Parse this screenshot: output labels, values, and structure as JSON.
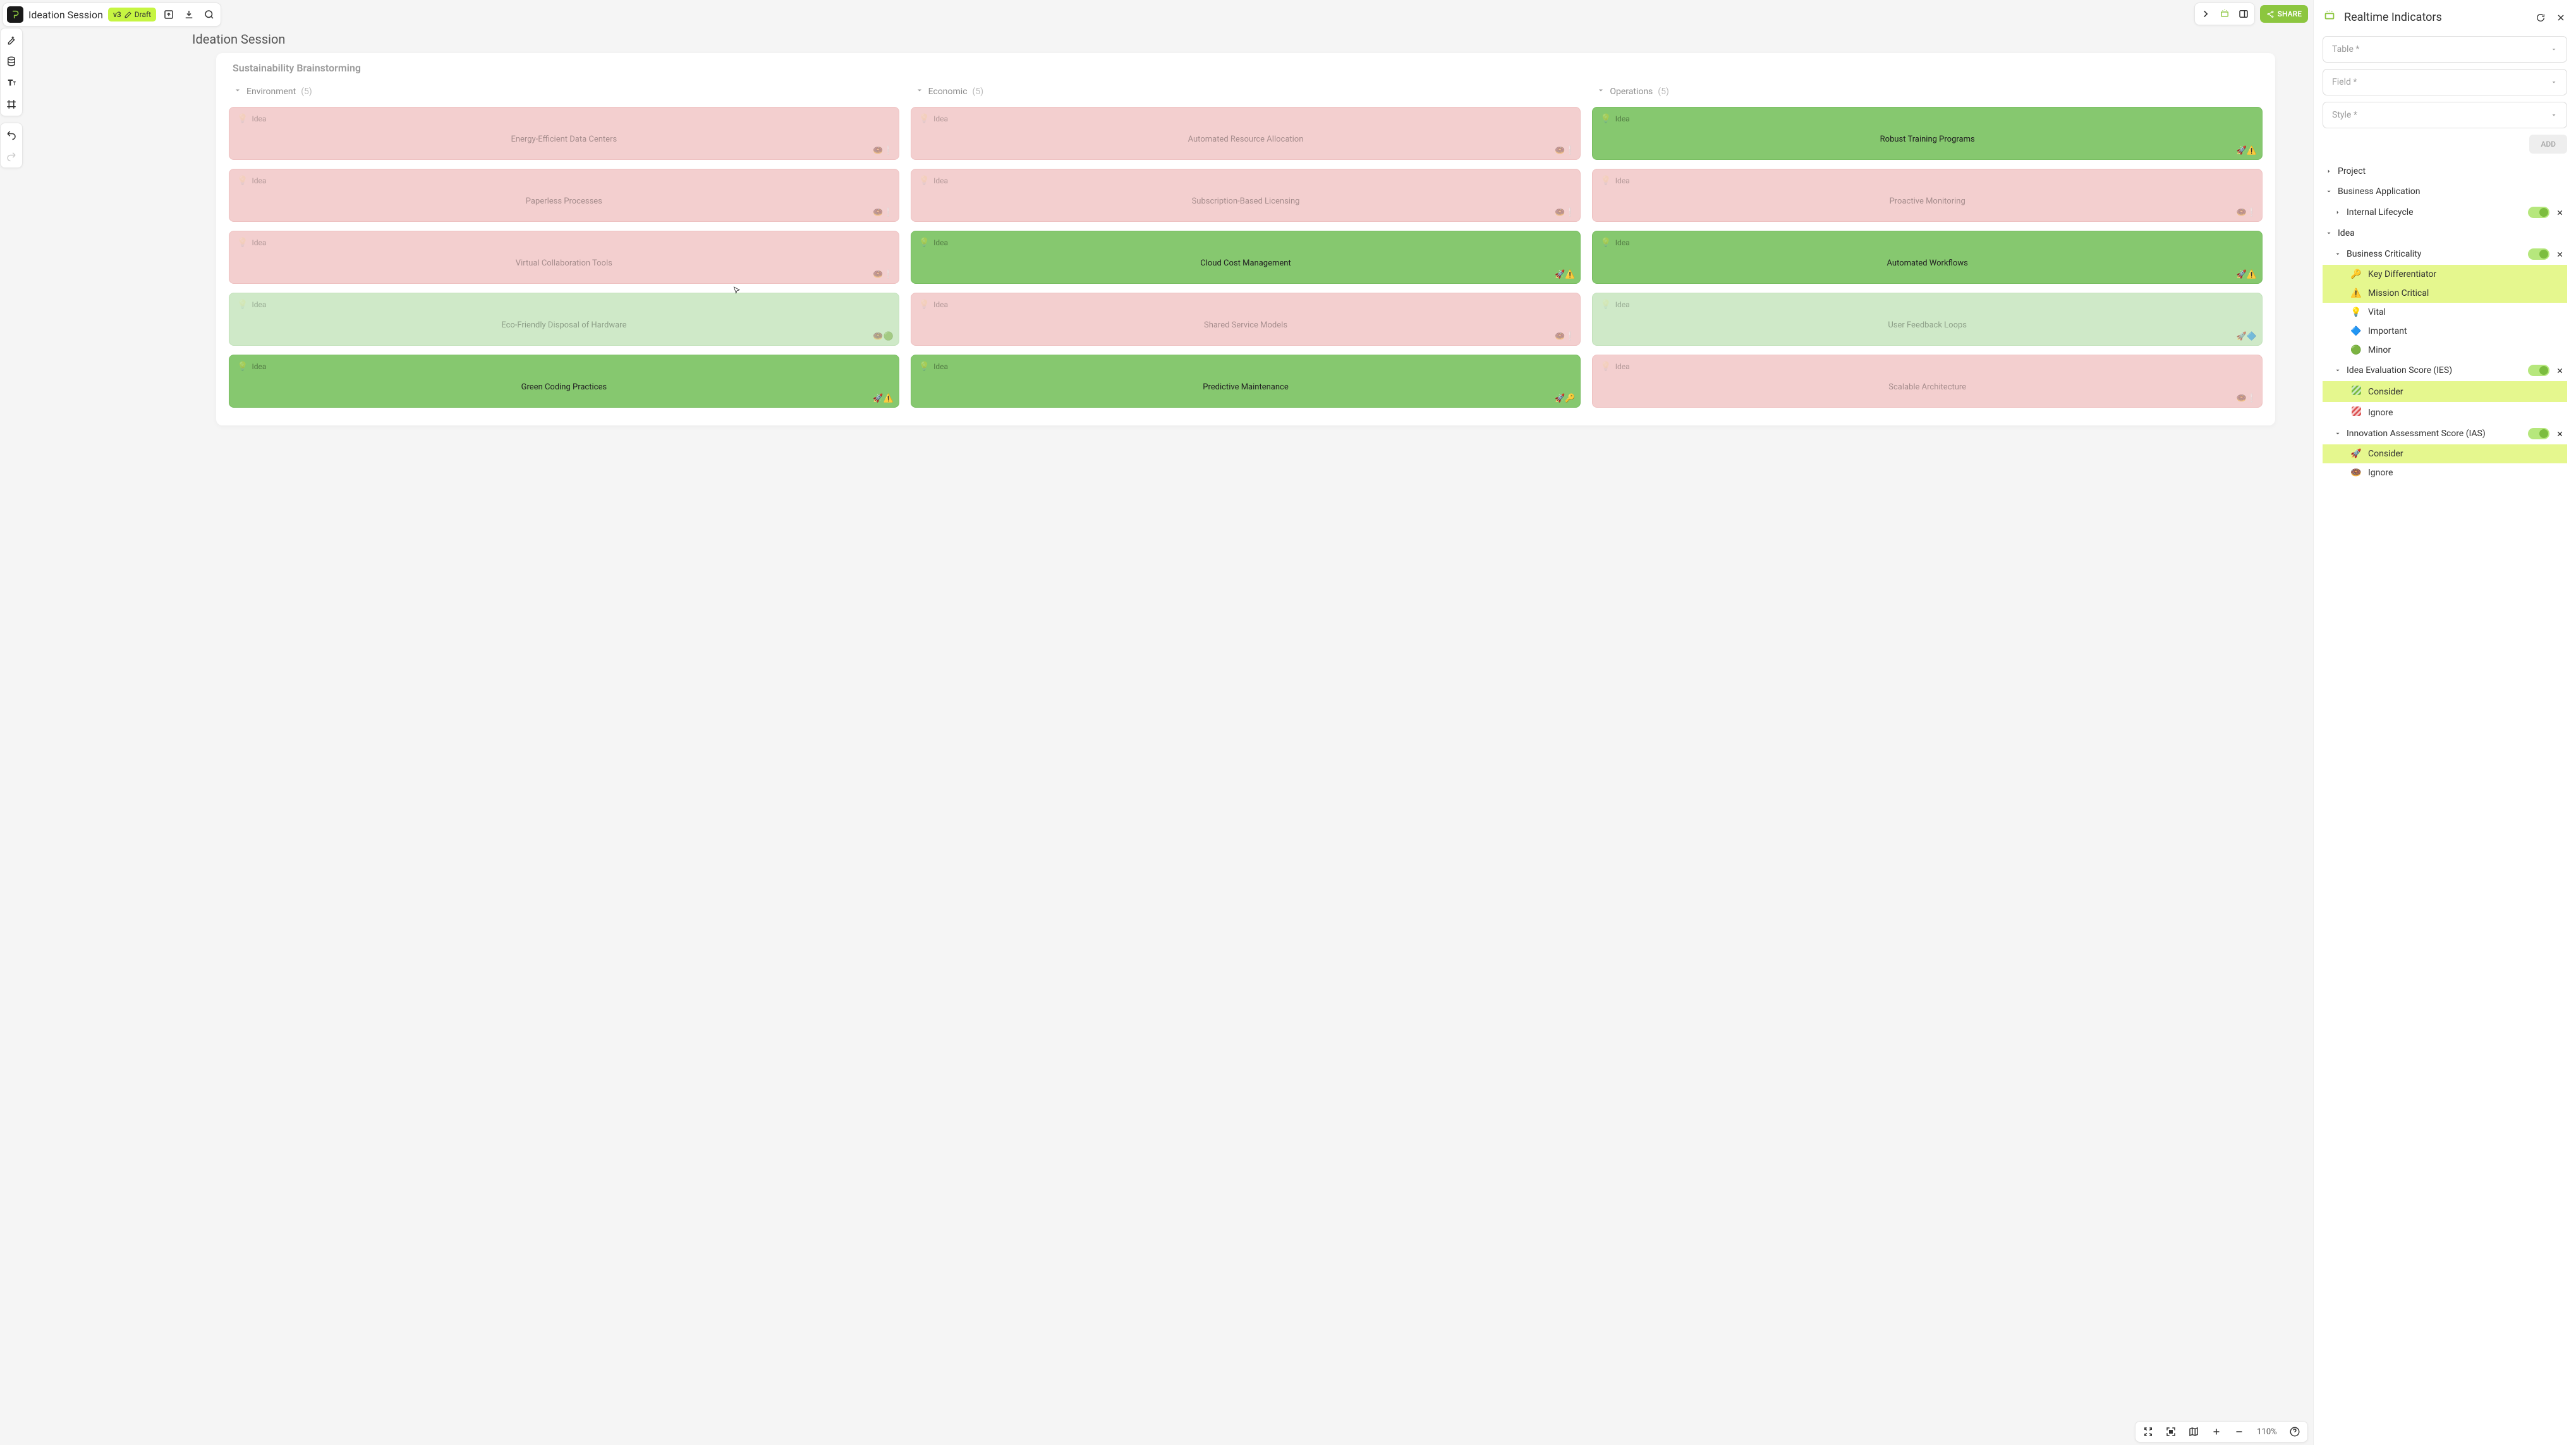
{
  "header": {
    "project_title": "Ideation Session",
    "version_label": "v3",
    "status_label": "Draft",
    "share_label": "SHARE"
  },
  "canvas": {
    "page_title": "Ideation Session",
    "board_title": "Sustainability Brainstorming",
    "idea_type_label": "Idea",
    "columns": [
      {
        "name": "Environment",
        "count": "(5)",
        "cards": [
          {
            "title": "Energy-Efficient Data Centers",
            "variant": "pink",
            "icons": [
              "🍩",
              "❕"
            ]
          },
          {
            "title": "Paperless Processes",
            "variant": "pink",
            "icons": [
              "🍩",
              "❕"
            ]
          },
          {
            "title": "Virtual Collaboration Tools",
            "variant": "pink",
            "icons": [
              "🍩",
              "❕"
            ]
          },
          {
            "title": "Eco-Friendly Disposal of Hardware",
            "variant": "greenlt",
            "icons": [
              "🍩",
              "🟢"
            ]
          },
          {
            "title": "Green Coding Practices",
            "variant": "green",
            "icons": [
              "🚀",
              "⚠️"
            ]
          }
        ]
      },
      {
        "name": "Economic",
        "count": "(5)",
        "cards": [
          {
            "title": "Automated Resource Allocation",
            "variant": "pink",
            "icons": [
              "🍩",
              "❕"
            ]
          },
          {
            "title": "Subscription-Based Licensing",
            "variant": "pink",
            "icons": [
              "🍩",
              "❕"
            ]
          },
          {
            "title": "Cloud Cost Management",
            "variant": "green",
            "icons": [
              "🚀",
              "⚠️"
            ]
          },
          {
            "title": "Shared Service Models",
            "variant": "pink",
            "icons": [
              "🍩",
              "❕"
            ]
          },
          {
            "title": "Predictive Maintenance",
            "variant": "green",
            "icons": [
              "🚀",
              "🔑"
            ]
          }
        ]
      },
      {
        "name": "Operations",
        "count": "(5)",
        "cards": [
          {
            "title": "Robust Training Programs",
            "variant": "green",
            "icons": [
              "🚀",
              "⚠️"
            ]
          },
          {
            "title": "Proactive Monitoring",
            "variant": "pink",
            "icons": [
              "🍩",
              "❕"
            ]
          },
          {
            "title": "Automated Workflows",
            "variant": "green",
            "icons": [
              "🚀",
              "⚠️"
            ]
          },
          {
            "title": "User Feedback Loops",
            "variant": "greenlt",
            "icons": [
              "🚀",
              "🔷"
            ]
          },
          {
            "title": "Scalable Architecture",
            "variant": "pink",
            "icons": [
              "🍩",
              "❕"
            ]
          }
        ]
      }
    ]
  },
  "bottom": {
    "zoom_label": "110%"
  },
  "panel": {
    "title": "Realtime Indicators",
    "dd_table": "Table *",
    "dd_field": "Field *",
    "dd_style": "Style *",
    "add_label": "ADD",
    "tree": {
      "project": "Project",
      "biz_app": "Business Application",
      "internal_lifecycle": "Internal Lifecycle",
      "idea": "Idea",
      "groups": [
        {
          "name": "Business Criticality",
          "items": [
            {
              "icon": "🔑",
              "label": "Key Differentiator",
              "hl": true
            },
            {
              "icon": "⚠️",
              "label": "Mission Critical",
              "hl": true
            },
            {
              "icon": "💡",
              "label": "Vital",
              "hl": false
            },
            {
              "icon": "🔷",
              "label": "Important",
              "hl": false
            },
            {
              "icon": "🟢",
              "label": "Minor",
              "hl": false
            }
          ]
        },
        {
          "name": "Idea Evaluation Score (IES)",
          "items": [
            {
              "icon": "stripe-green",
              "label": "Consider",
              "hl": true
            },
            {
              "icon": "stripe-red",
              "label": "Ignore",
              "hl": false
            }
          ]
        },
        {
          "name": "Innovation Assessment Score (IAS)",
          "items": [
            {
              "icon": "🚀",
              "label": "Consider",
              "hl": true
            },
            {
              "icon": "🍩",
              "label": "Ignore",
              "hl": false
            }
          ]
        }
      ]
    }
  }
}
